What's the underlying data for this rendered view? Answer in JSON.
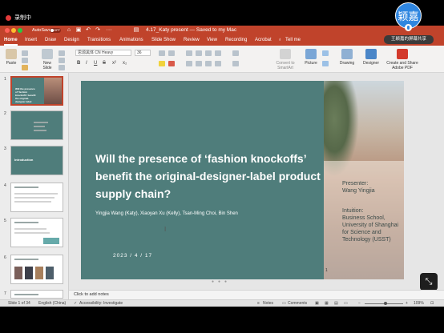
{
  "recording": {
    "label": "录制中",
    "avatar_text": "颖嘉",
    "share_text": "王颖嘉的屏幕共享"
  },
  "titlebar": {
    "autosave": "AutoSave",
    "autosave_state": "OFF",
    "doc_title": "4.17_Katy present — Saved to my Mac"
  },
  "tabs": [
    "Home",
    "Insert",
    "Draw",
    "Design",
    "Transitions",
    "Animations",
    "Slide Show",
    "Review",
    "View",
    "Recording",
    "Acrobat",
    "Tell me"
  ],
  "ribbon": {
    "paste": "Paste",
    "new_slide": "New Slide",
    "font": "思源黑体 CN Heavy",
    "size": "36",
    "convert": "Convert to SmartArt",
    "picture": "Picture",
    "drawing": "Drawing",
    "designer": "Designer",
    "adobe": "Create and Share Adobe PDF",
    "format_buttons": [
      "B",
      "I",
      "U",
      "S",
      "x²",
      "x₂"
    ]
  },
  "thumbnails": {
    "numbers": [
      "1",
      "2",
      "3",
      "4",
      "5",
      "6",
      "7"
    ],
    "slide1_title": "Will the presence of ‘fashion knockoffs’ benefit the original-designer-label product supply chain?",
    "slide3_title": "Introduction"
  },
  "slide": {
    "title": "Will the presence of ‘fashion knockoffs’ benefit the original-designer-label product supply chain?",
    "authors": "Yingjia Wang (Katy), Xiaoyan Xu (Kelly), Tsan-Ming Choi, Bin Shen",
    "date": "2023 / 4 / 17",
    "presenter_label": "Presenter:",
    "presenter_name": "Wang Yingjia",
    "intuition_label": "Intuition:",
    "intuition_value": "Business School, University of Shanghai for Science and Technology (USST)",
    "page_number": "1"
  },
  "notes": {
    "placeholder": "Click to add notes"
  },
  "status": {
    "slide_count": "Slide 1 of 34",
    "language": "English (China)",
    "accessibility": "Accessibility: Investigate",
    "notes": "Notes",
    "comments": "Comments",
    "zoom": "109%"
  },
  "colors": {
    "accent": "#c0432b",
    "slide_bg": "#4f7d7b"
  }
}
